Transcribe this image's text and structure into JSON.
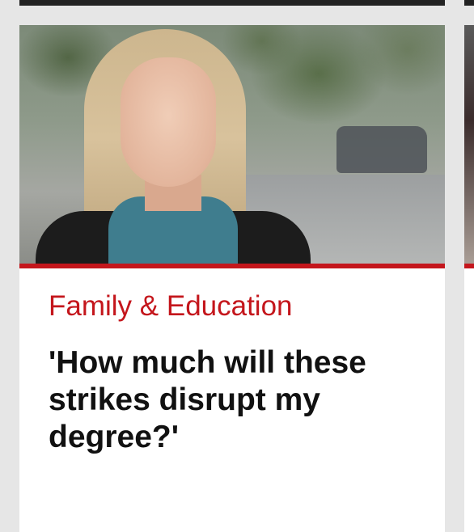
{
  "story": {
    "section": "Family & Education",
    "headline": "'How much will these strikes disrupt my degree?'",
    "image_alt": "Student with blonde hair standing on a tree-lined street"
  },
  "colors": {
    "accent": "#c4161c",
    "background": "#e6e6e6",
    "card": "#ffffff",
    "headline": "#111111"
  }
}
